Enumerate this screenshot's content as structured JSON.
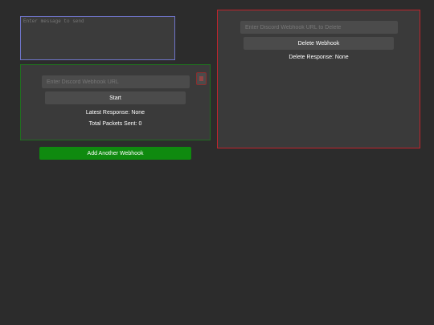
{
  "message": {
    "placeholder": "Enter message to send",
    "value": ""
  },
  "webhook": {
    "url_placeholder": "Enter Discord Webhook URL",
    "url_value": "",
    "remove_icon": "close-icon",
    "start_label": "Start",
    "latest_response": "Latest Response: None",
    "total_packets": "Total Packets Sent: 0"
  },
  "add_webhook_label": "Add Another Webhook",
  "delete": {
    "url_placeholder": "Enter Discord Webhook URL to Delete",
    "url_value": "",
    "button_label": "Delete Webhook",
    "response": "Delete Response: None"
  },
  "colors": {
    "background": "#2c2c2c",
    "panel": "#3a3a3a",
    "message_border": "#6e74c8",
    "webhook_border": "#1f6e1f",
    "delete_border": "#c0242c",
    "add_button": "#0f8a0f"
  }
}
